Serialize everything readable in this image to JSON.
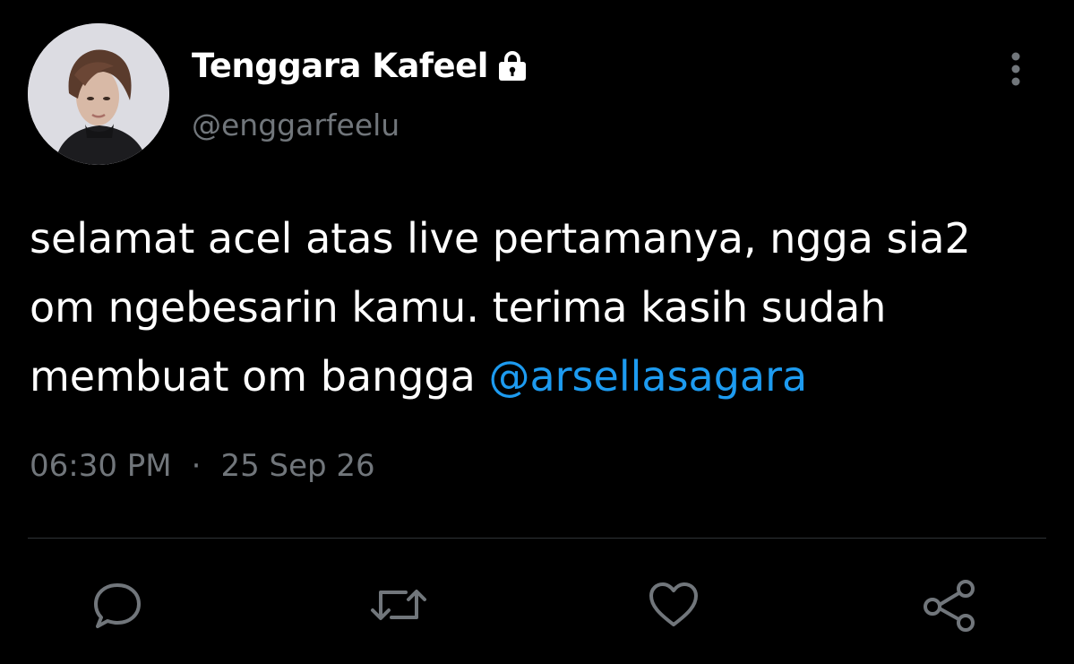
{
  "tweet": {
    "author": {
      "display_name": "Tenggara Kafeel",
      "handle": "@enggarfeelu",
      "protected_icon": "lock-icon"
    },
    "text_parts": [
      "selamat acel atas live pertamanya, ngga sia2\nom ngebesarin kamu. terima kasih sudah\nmembuat om bangga ",
      "@arsellasagara"
    ],
    "time": "06:30 PM",
    "separator": "·",
    "date": "25 Sep 26",
    "more_icon": "more-vertical-icon"
  },
  "actions": [
    {
      "name": "reply",
      "icon": "comment-icon"
    },
    {
      "name": "retweet",
      "icon": "retweet-icon"
    },
    {
      "name": "like",
      "icon": "heart-icon"
    },
    {
      "name": "share",
      "icon": "share-icon"
    }
  ],
  "colors": {
    "background": "#000000",
    "text": "#ffffff",
    "secondary_text": "#71767b",
    "mention": "#1d9bf0",
    "divider": "#2f3336"
  }
}
